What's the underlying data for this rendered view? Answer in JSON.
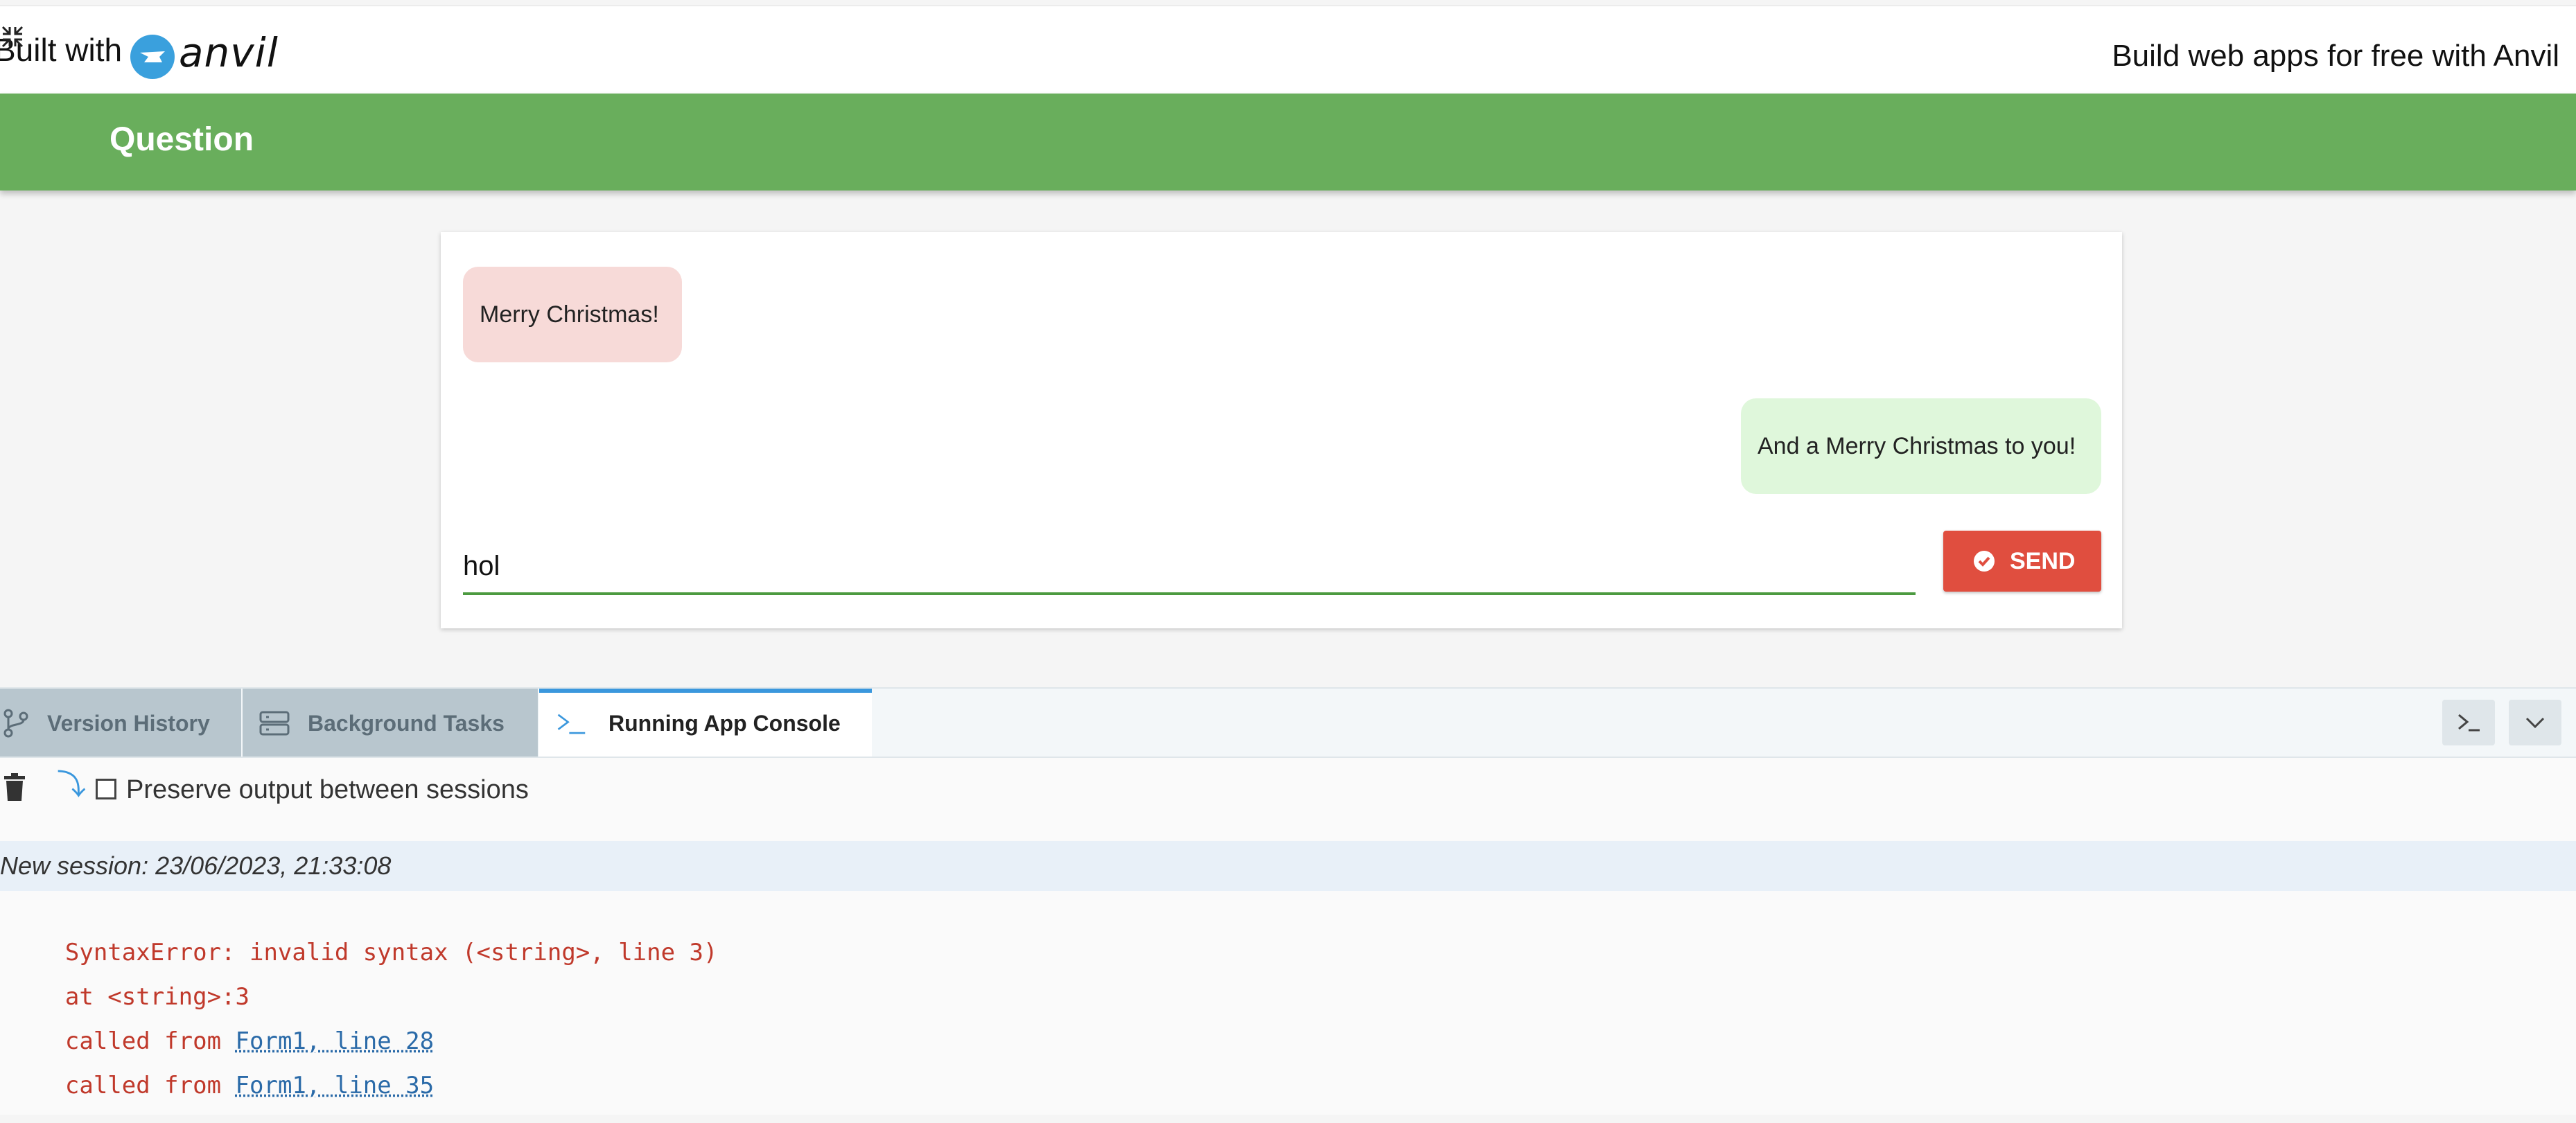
{
  "topbar": {
    "built_with": "Built with",
    "brand": "anvil",
    "promo_text": "Build web apps for free with Anvil"
  },
  "header": {
    "title": "Question"
  },
  "chat": {
    "messages": [
      {
        "side": "left",
        "text": "Merry Christmas!"
      },
      {
        "side": "right",
        "text": "And a Merry Christmas to you!"
      }
    ],
    "input_value": "hol",
    "send_label": "SEND"
  },
  "console": {
    "tabs": [
      {
        "label": "Version History",
        "icon": "branch-icon",
        "active": false
      },
      {
        "label": "Background Tasks",
        "icon": "tasks-icon",
        "active": false
      },
      {
        "label": "Running App Console",
        "icon": "terminal-icon",
        "active": true
      }
    ],
    "preserve_label": "Preserve output between sessions",
    "preserve_checked": false,
    "session_header": "New session: 23/06/2023, 21:33:08",
    "output": [
      {
        "prefix": "SyntaxError: invalid syntax (<string>, line 3)",
        "link": ""
      },
      {
        "prefix": "at <string>:3",
        "link": ""
      },
      {
        "prefix": "called from ",
        "link": "Form1, line 28"
      },
      {
        "prefix": "called from ",
        "link": "Form1, line 35"
      }
    ]
  },
  "colors": {
    "header_green": "#69ae5c",
    "send_red": "#e04e3f",
    "bubble_left": "#f7dad8",
    "bubble_right": "#dff7db",
    "error_red": "#c0392b",
    "link_blue": "#2a6aa8",
    "active_tab_accent": "#3a97dd"
  }
}
